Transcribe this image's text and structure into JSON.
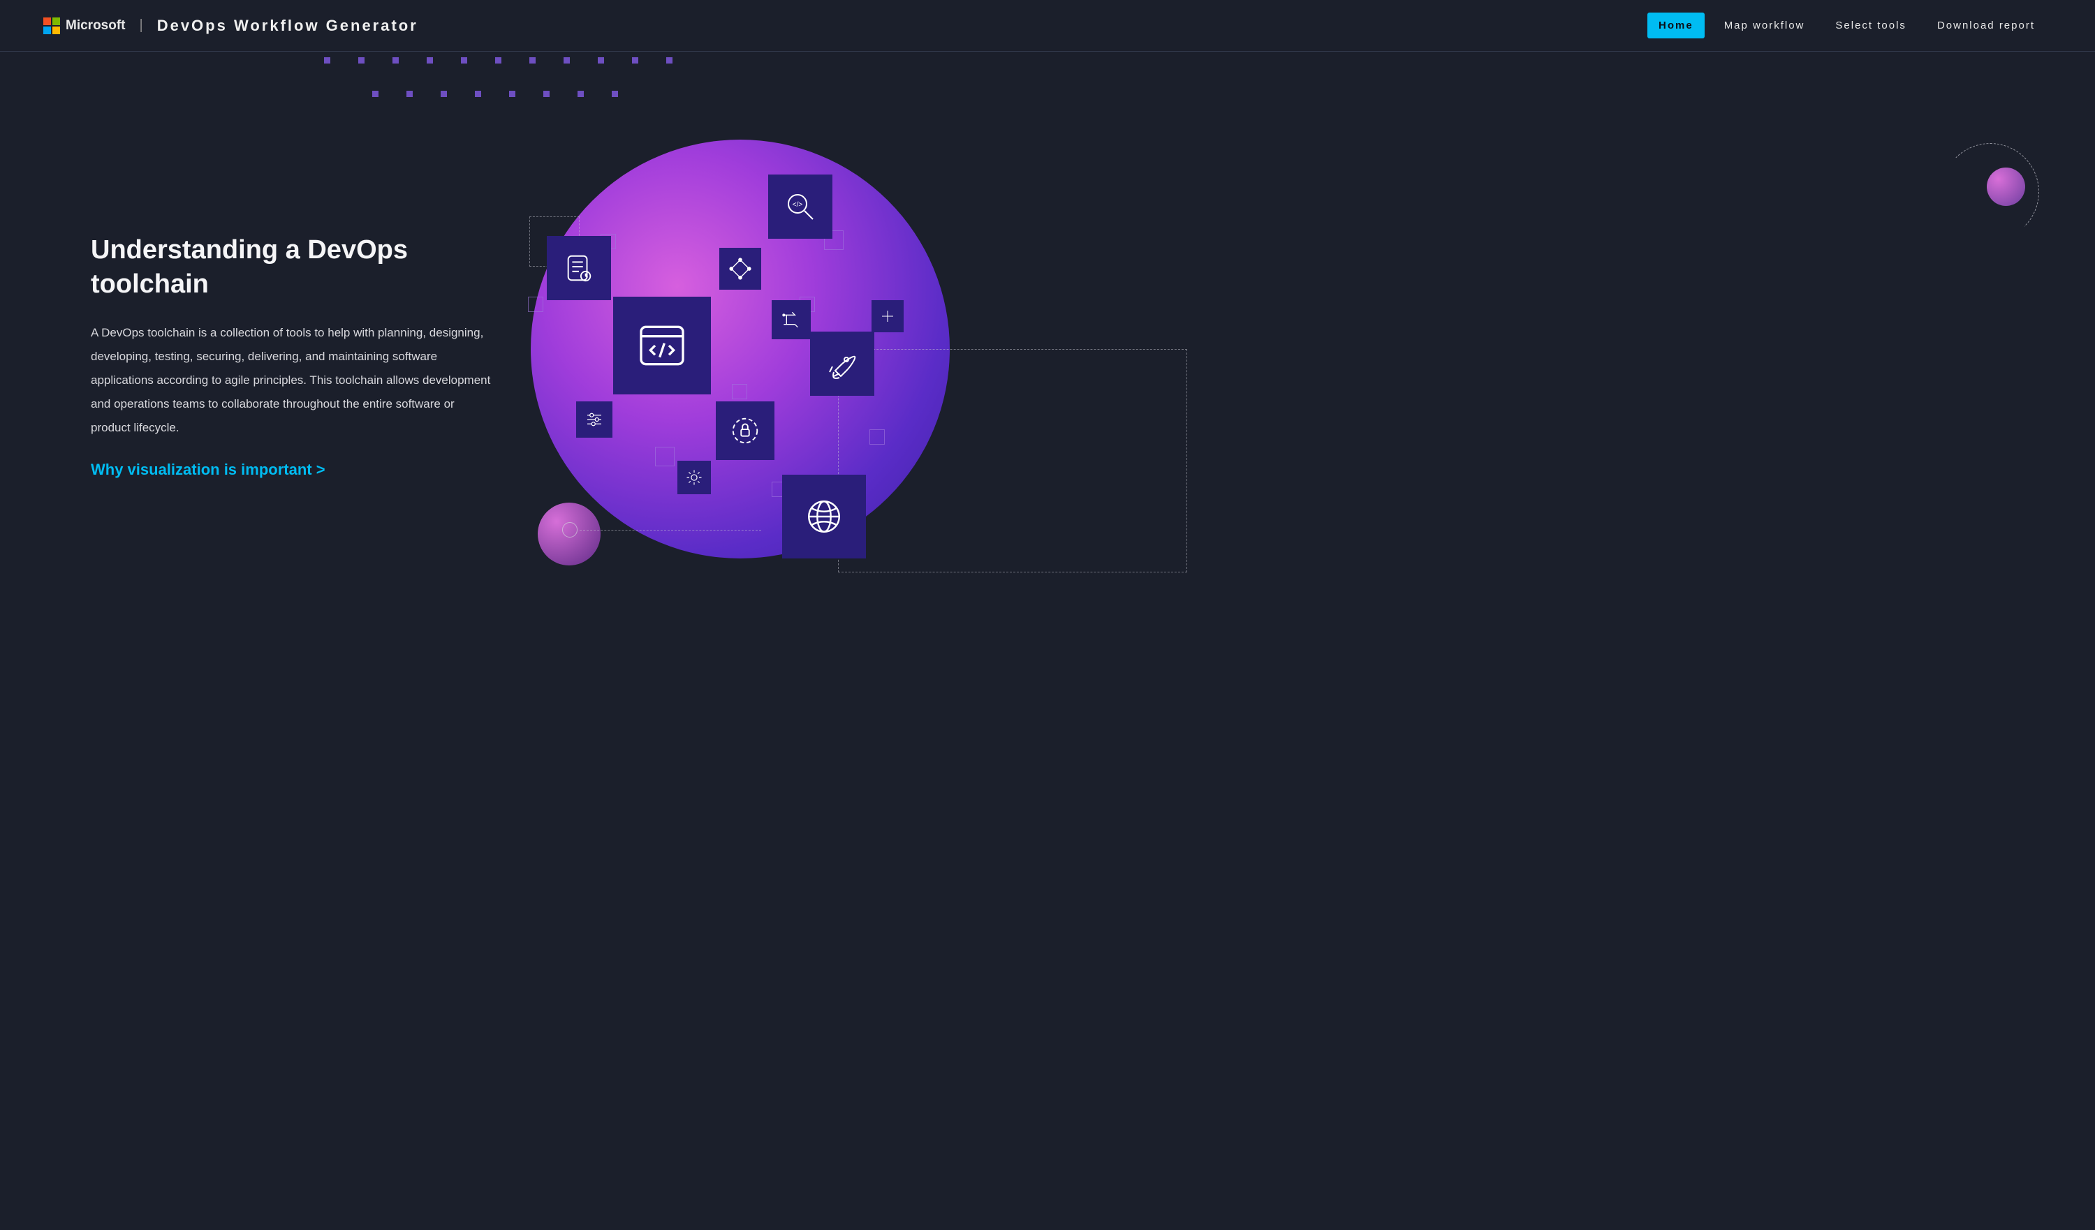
{
  "brand": {
    "company": "Microsoft",
    "app": "DevOps Workflow Generator"
  },
  "nav": {
    "items": [
      {
        "label": "Home",
        "active": true
      },
      {
        "label": "Map workflow",
        "active": false
      },
      {
        "label": "Select tools",
        "active": false
      },
      {
        "label": "Download report",
        "active": false
      }
    ]
  },
  "main": {
    "heading": "Understanding a DevOps toolchain",
    "body": "A DevOps toolchain is a collection of tools to help with planning, designing, developing, testing, securing, delivering, and maintaining software applications according to agile principles. This toolchain allows development and operations teams to collaborate throughout the entire software or product lifecycle.",
    "cta": "Why visualization is important  >"
  },
  "illustration": {
    "icons": [
      "code-search-icon",
      "checklist-icon",
      "graph-icon",
      "route-icon",
      "plus-icon",
      "code-window-icon",
      "rocket-icon",
      "sliders-icon",
      "lock-target-icon",
      "gear-icon",
      "globe-icon"
    ]
  },
  "colors": {
    "background": "#1b1f2b",
    "accent": "#00bcf2",
    "tile": "#2a1e7a",
    "gradient_from": "#d65fde",
    "gradient_to": "#3b1fa3"
  }
}
